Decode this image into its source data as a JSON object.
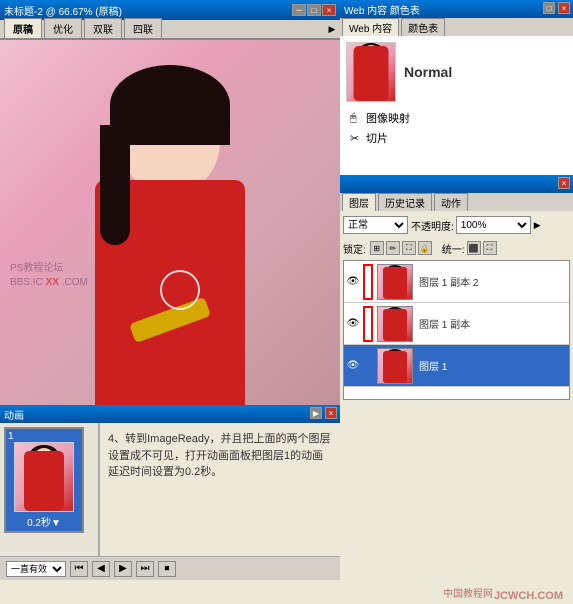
{
  "window": {
    "title": "未标题-2 @ 66.67% (原稿)",
    "buttons": {
      "minimize": "－",
      "maximize": "□",
      "close": "×"
    }
  },
  "doc": {
    "title": "未标题-2 @ 66.67% (原稿)",
    "tabs": [
      "原稿",
      "优化",
      "双联",
      "四联"
    ],
    "active_tab": "原稿",
    "scale": "66.679%"
  },
  "right_panel": {
    "title": "Web 内容  颜色表",
    "tabs": [
      "Web 内容",
      "颜色表"
    ],
    "active_tab": "Web 内容",
    "normal_label": "Normal",
    "menu_items": [
      {
        "icon": "cursor",
        "label": "图像映射"
      },
      {
        "icon": "scissors",
        "label": "切片"
      }
    ]
  },
  "layers_panel": {
    "title_tabs": [
      "图层",
      "历史记录",
      "动作"
    ],
    "active_tab": "图层",
    "blend_mode_label": "正常",
    "opacity_label": "不透明度:",
    "opacity_value": "100%",
    "lock_label": "锁定:",
    "fill_label": "统一:",
    "layers": [
      {
        "name": "图层 1 副本 2",
        "visible": true,
        "active": false
      },
      {
        "name": "图层 1 副本",
        "visible": true,
        "active": false
      },
      {
        "name": "图层 1",
        "visible": true,
        "active": true
      }
    ]
  },
  "anim_panel": {
    "title": "动画",
    "frame_number": "1",
    "frame_time": "0.2秒▼",
    "instruction_text": "4、转到ImageReady，并且把上面的两个图层设置成不可见，打开动画面板把图层1的动画延迟时间设置为0.2秒。",
    "loop_label": "一直有效▼",
    "controls": [
      "⏮",
      "◀",
      "▶",
      "⏭",
      "⏏"
    ]
  },
  "bottom_watermark": "JCWCH.COM",
  "watermark_lines": [
    "PS教程论坛",
    "BBS.IC XX .COM"
  ]
}
